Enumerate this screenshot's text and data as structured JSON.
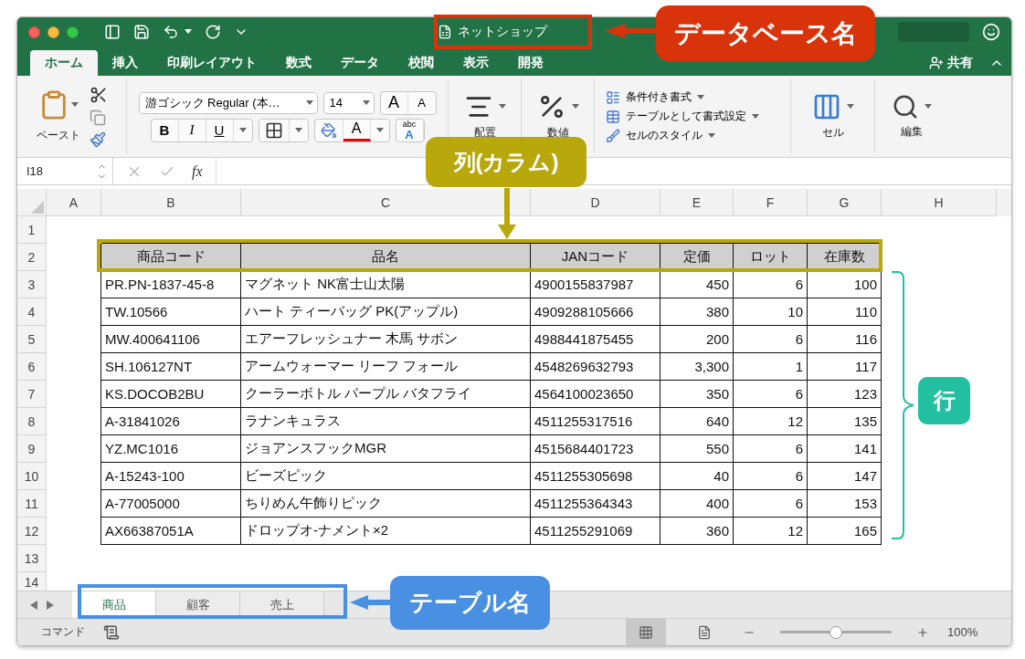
{
  "window": {
    "title": "ネットショップ"
  },
  "ribbon_tabs": [
    {
      "label": "ホーム",
      "selected": true
    },
    {
      "label": "挿入",
      "selected": false
    },
    {
      "label": "印刷レイアウト",
      "selected": false
    },
    {
      "label": "数式",
      "selected": false
    },
    {
      "label": "データ",
      "selected": false
    },
    {
      "label": "校閲",
      "selected": false
    },
    {
      "label": "表示",
      "selected": false
    },
    {
      "label": "開発",
      "selected": false
    }
  ],
  "share": {
    "label": "共有"
  },
  "ribbon": {
    "paste": "ペースト",
    "font_name": "游ゴシック Regular (本…",
    "font_size": "14",
    "grow_font": "A",
    "shrink_font": "A",
    "bold": "B",
    "italic": "I",
    "underline": "U",
    "font_color": "A",
    "phonetic_top": "abc",
    "phonetic_bottom": "A",
    "alignment": "配置",
    "number": "数値",
    "styles": [
      "条件付き書式",
      "テーブルとして書式設定",
      "セルのスタイル"
    ],
    "cells": "セル",
    "editing": "編集"
  },
  "formula_bar": {
    "cell_ref": "I18",
    "function_label": "fx"
  },
  "sheet": {
    "column_letters": [
      "A",
      "B",
      "C",
      "D",
      "E",
      "F",
      "G",
      "H"
    ],
    "row_numbers": [
      "1",
      "2",
      "3",
      "4",
      "5",
      "6",
      "7",
      "8",
      "9",
      "10",
      "11",
      "12",
      "13",
      "14"
    ],
    "table": {
      "columns": [
        "商品コード",
        "品名",
        "JANコード",
        "定価",
        "ロット",
        "在庫数"
      ],
      "rows": [
        [
          "PR.PN-1837-45-8",
          "マグネット NK富士山太陽",
          "4900155837987",
          "450",
          "6",
          "100"
        ],
        [
          "TW.10566",
          "ハート ティーバッグ PK(アップル)",
          "4909288105666",
          "380",
          "10",
          "110"
        ],
        [
          "MW.400641106",
          "エアーフレッシュナー 木馬  サボン",
          "4988441875455",
          "200",
          "6",
          "116"
        ],
        [
          "SH.106127NT",
          "アームウォーマー リーフ フォール",
          "4548269632793",
          "3,300",
          "1",
          "117"
        ],
        [
          "KS.DOCOB2BU",
          "クーラーボトル パープル バタフライ",
          "4564100023650",
          "350",
          "6",
          "123"
        ],
        [
          "A-31841026",
          "ラナンキュラス",
          "4511255317516",
          "640",
          "12",
          "135"
        ],
        [
          "YZ.MC1016",
          "ジョアンスフックMGR",
          "4515684401723",
          "550",
          "6",
          "141"
        ],
        [
          "A-15243-100",
          "ビーズピック",
          "4511255305698",
          "40",
          "6",
          "147"
        ],
        [
          "A-77005000",
          "ちりめん午飾りピック",
          "4511255364343",
          "400",
          "6",
          "153"
        ],
        [
          "AX66387051A",
          "ドロップオ-ナメント×2",
          "4511255291069",
          "360",
          "12",
          "165"
        ]
      ]
    }
  },
  "sheet_tabs": [
    {
      "label": "商品",
      "selected": true
    },
    {
      "label": "顧客",
      "selected": false
    },
    {
      "label": "売上",
      "selected": false
    }
  ],
  "status_bar": {
    "mode": "コマンド",
    "zoom": {
      "level": 0.5
    },
    "zoom_label": "100%"
  },
  "annotations": [
    {
      "kind": "title",
      "text": "データベース名",
      "color": "#d9330b"
    },
    {
      "kind": "columns",
      "text": "列(カラム)",
      "color": "#b9a80b"
    },
    {
      "kind": "rows",
      "text": "行",
      "color": "#22bfa0"
    },
    {
      "kind": "tables",
      "text": "テーブル名",
      "color": "#4a90e2"
    }
  ]
}
